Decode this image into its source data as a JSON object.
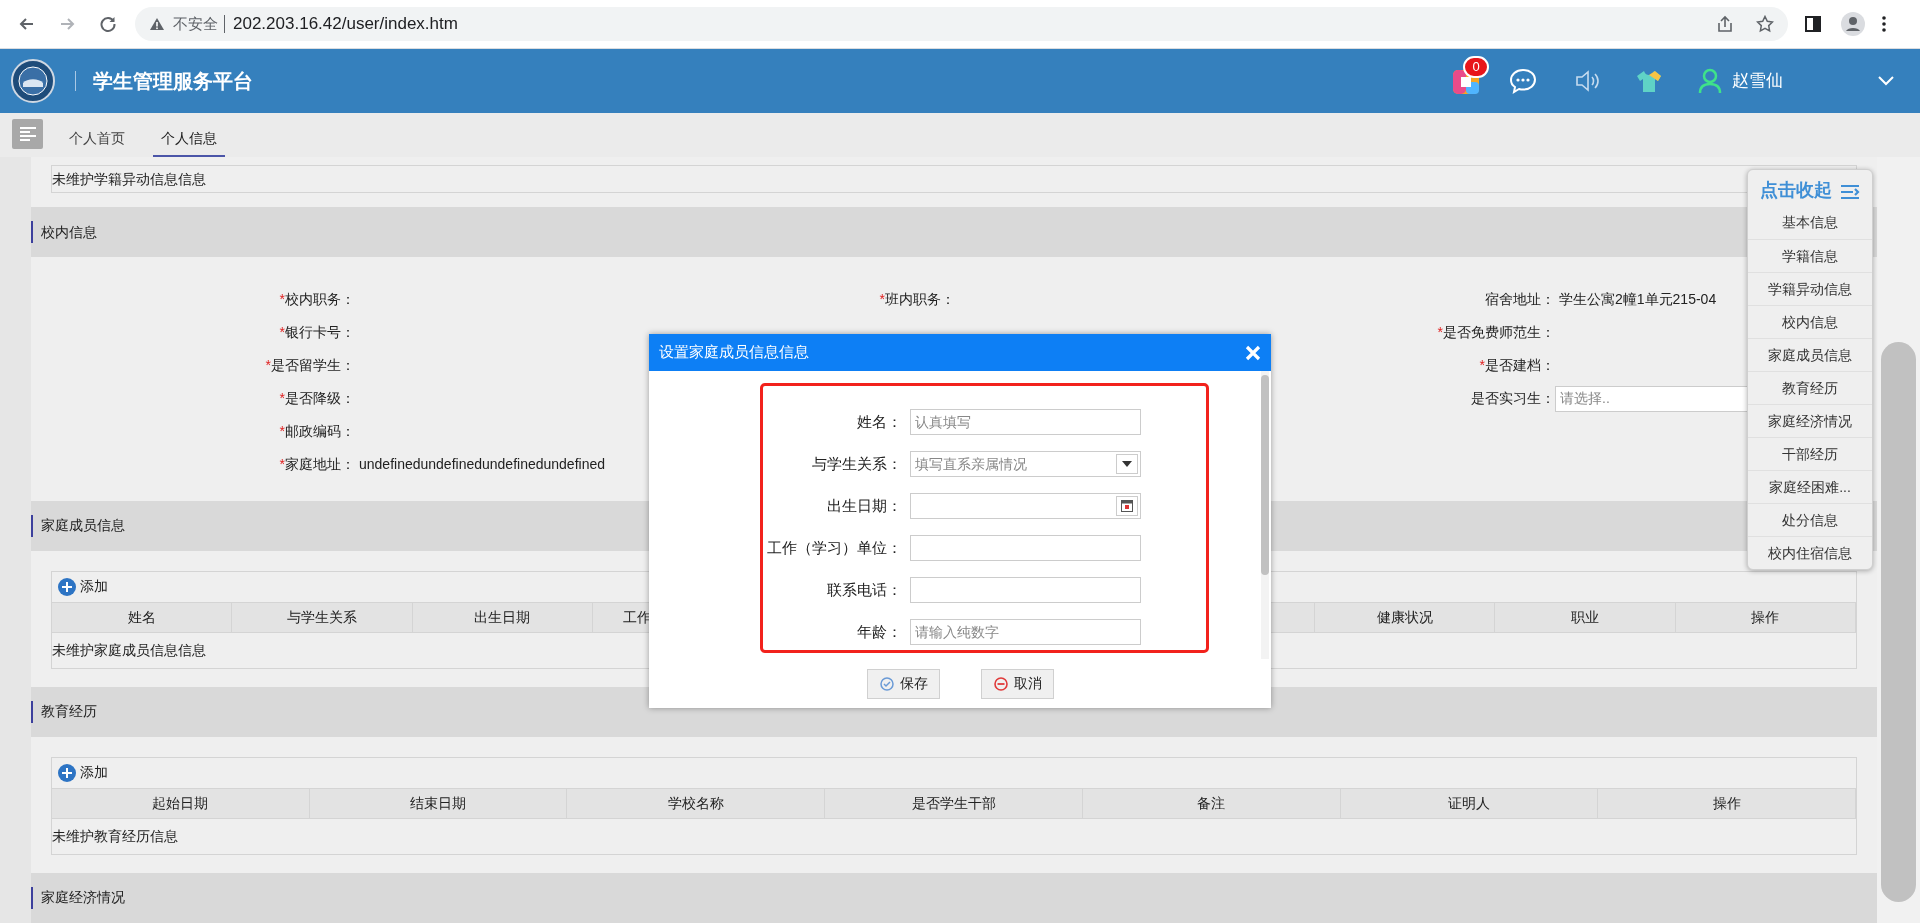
{
  "browser": {
    "security_label": "不安全",
    "url": "202.203.16.42/user/index.htm"
  },
  "header": {
    "title": "学生管理服务平台",
    "notification_count": "0",
    "user_name": "赵雪仙"
  },
  "tabs": [
    {
      "label": "个人首页",
      "selected": false
    },
    {
      "label": "个人信息",
      "selected": true
    }
  ],
  "top_table_empty": "未维护学籍异动信息信息",
  "sections": [
    {
      "kind": "form",
      "title": "校内信息",
      "columns": [
        [
          {
            "required_mark": "*",
            "label": "校内职务：",
            "kind": "text"
          },
          {
            "required_mark": "*",
            "label": "银行卡号：",
            "kind": "text"
          },
          {
            "required_mark": "*",
            "label": "是否留学生：",
            "kind": "text"
          },
          {
            "required_mark": "*",
            "label": "是否降级：",
            "kind": "text"
          },
          {
            "required_mark": "*",
            "label": "邮政编码：",
            "kind": "text"
          },
          {
            "required_mark": "*",
            "label": "家庭地址：",
            "kind": "text",
            "value": "undefinedundefinedundefinedundefined"
          }
        ],
        [
          {
            "required_mark": "*",
            "label": "班内职务：",
            "kind": "text"
          }
        ],
        [
          {
            "label": "宿舍地址：",
            "kind": "text",
            "value": "学生公寓2幢1单元215-04"
          },
          {
            "required_mark": "*",
            "label": "是否免费师范生：",
            "kind": "text"
          },
          {
            "required_mark": "*",
            "label": "是否建档：",
            "kind": "text"
          },
          {
            "label": "是否实习生：",
            "kind": "select",
            "placeholder": "请选择.."
          }
        ]
      ]
    },
    {
      "kind": "table",
      "title": "家庭成员信息",
      "add_label": "添加",
      "partly_covered": true,
      "columns": [
        "姓名",
        "与学生关系",
        "出生日期",
        "工作",
        "健康状况",
        "职业",
        "操作"
      ],
      "empty_text": "未维护家庭成员信息信息"
    },
    {
      "kind": "table",
      "title": "教育经历",
      "add_label": "添加",
      "partly_covered": false,
      "columns": [
        "起始日期",
        "结束日期",
        "学校名称",
        "是否学生干部",
        "备注",
        "证明人",
        "操作"
      ],
      "empty_text": "未维护教育经历信息"
    },
    {
      "kind": "heading",
      "title": "家庭经济情况"
    }
  ],
  "dialog": {
    "title": "设置家庭成员信息信息",
    "fields": [
      {
        "label": "姓名：",
        "kind": "text",
        "placeholder": "认真填写"
      },
      {
        "label": "与学生关系：",
        "kind": "select",
        "placeholder": "填写直系亲属情况"
      },
      {
        "label": "出生日期：",
        "kind": "date"
      },
      {
        "label": "工作（学习）单位：",
        "kind": "text"
      },
      {
        "label": "联系电话：",
        "kind": "text"
      },
      {
        "label": "年龄：",
        "kind": "text",
        "placeholder": "请输入纯数字"
      }
    ],
    "buttons": [
      {
        "label": "保存",
        "kind": "save"
      },
      {
        "label": "取消",
        "kind": "cancel"
      }
    ]
  },
  "side_menu": {
    "title": "点击收起",
    "items": [
      "基本信息",
      "学籍信息",
      "学籍异动信息",
      "校内信息",
      "家庭成员信息",
      "教育经历",
      "家庭经济情况",
      "干部经历",
      "家庭经困难...",
      "处分信息",
      "校内住宿信息"
    ]
  }
}
